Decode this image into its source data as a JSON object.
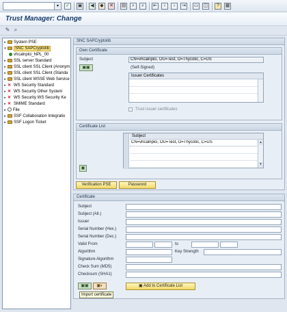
{
  "title": "Trust Manager: Change",
  "tree": {
    "items": [
      {
        "label": "System PSE",
        "icon": "folder",
        "type": "folder"
      },
      {
        "label": "SNC SAPCryptolib",
        "icon": "folder",
        "type": "folder",
        "selected": true
      },
      {
        "label": "vhcalnplci_NPL_00",
        "icon": "green-dot",
        "type": "child"
      },
      {
        "label": "SSL server Standard",
        "icon": "folder",
        "type": "folder"
      },
      {
        "label": "SSL client SSL Client (Anonym",
        "icon": "folder",
        "type": "folder"
      },
      {
        "label": "SSL client SSL Client (Standa",
        "icon": "folder",
        "type": "folder"
      },
      {
        "label": "SSL client WSSE Web Service",
        "icon": "folder",
        "type": "folder"
      },
      {
        "label": "WS Security Standard",
        "icon": "red-x",
        "type": "x"
      },
      {
        "label": "WS Security Other System",
        "icon": "red-x",
        "type": "x"
      },
      {
        "label": "WS Security WS Security Ke",
        "icon": "red-x",
        "type": "x"
      },
      {
        "label": "SMIME Standard",
        "icon": "red-x",
        "type": "x"
      },
      {
        "label": "File",
        "icon": "certificate",
        "type": "cert"
      },
      {
        "label": "SSF Collaboration Integratio",
        "icon": "folder",
        "type": "folder"
      },
      {
        "label": "SSF Logon Ticket",
        "icon": "folder",
        "type": "folder"
      }
    ]
  },
  "pse": {
    "header": "SNC SAPCryptolib",
    "own_cert": {
      "title": "Own Certificate",
      "subject_label": "Subject",
      "subject_value": "CN=vhcalnplci, OU=Test, O=Thycotic, C=US",
      "signed_status": "(Self-Signed)",
      "issuer_header": "Issuer Certificates",
      "trust_label": "Trust issuer certificates"
    },
    "cert_list": {
      "title": "Certificate List",
      "header": "Subject",
      "row": "CN=vhcalnplci, OU=Test, O=Thycotic, C=US"
    },
    "verification_btn": "Verification PSE",
    "password_btn": "Password"
  },
  "certificate": {
    "title": "Certificate",
    "fields": {
      "subject": "Subject",
      "subject_alt": "Subject (Alt.)",
      "issuer": "Issuer",
      "serial_hex": "Serial Number (Hex.)",
      "serial_dec": "Serial Number (Dec.)",
      "valid_from": "Valid From",
      "to": "to",
      "algorithm": "Algorithm",
      "key_strength": "Key Strength",
      "signature_algorithm": "Signature Algorithm",
      "checksum_md5": "Check Sum (MD5)",
      "checksum_sha1": "Checksum (SHA1)"
    },
    "add_btn": "Add to Certificate List",
    "tooltip": "Import certificate"
  },
  "icons": {
    "toolbar": [
      "enter-icon",
      "save-icon",
      "back-icon",
      "exit-icon",
      "cancel-icon",
      "print-icon",
      "find-icon",
      "find-next-icon",
      "first-page-icon",
      "prev-page-icon",
      "next-page-icon",
      "last-page-icon",
      "new-session-icon",
      "shortcut-icon",
      "help-icon",
      "customize-icon"
    ]
  }
}
